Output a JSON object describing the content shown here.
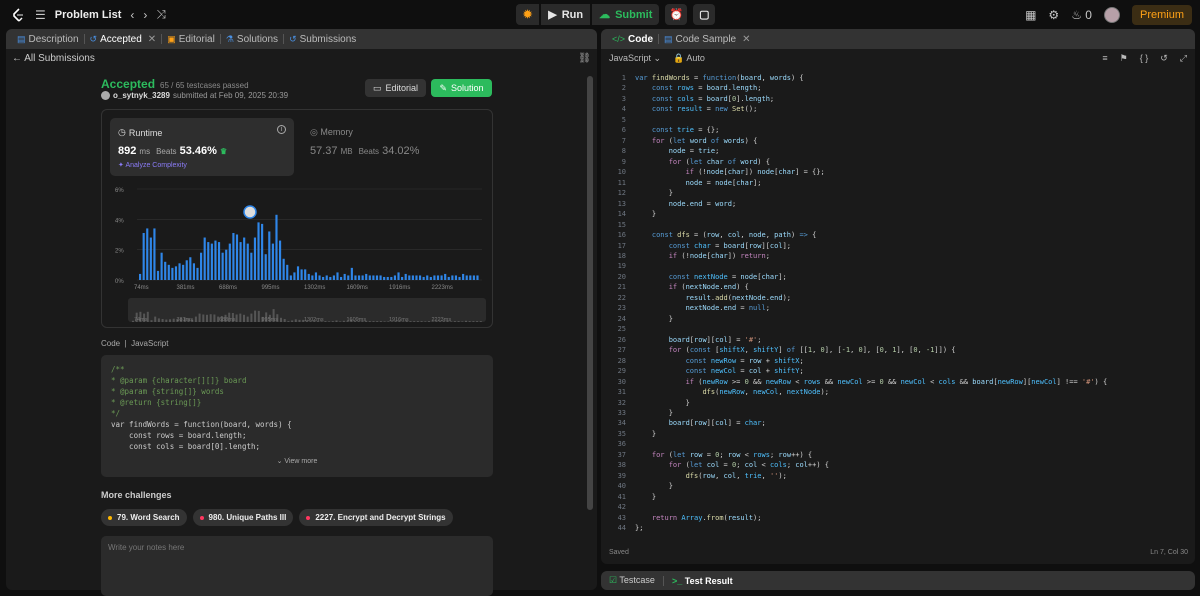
{
  "topbar": {
    "problem_list": "Problem List",
    "run": "Run",
    "submit": "Submit",
    "streak": "0",
    "premium": "Premium"
  },
  "left_tabs": [
    "Description",
    "Accepted",
    "Editorial",
    "Solutions",
    "Submissions"
  ],
  "all_submissions": "All Submissions",
  "result": {
    "status": "Accepted",
    "testcases": "65 / 65 testcases passed",
    "user": "o_sytnyk_3289",
    "submitted": "submitted at Feb 09, 2025 20:39",
    "editorial_btn": "Editorial",
    "solution_btn": "Solution"
  },
  "runtime": {
    "title": "Runtime",
    "value": "892",
    "unit": "ms",
    "beats_label": "Beats",
    "beats": "53.46%",
    "analyze": "Analyze Complexity"
  },
  "memory": {
    "title": "Memory",
    "value": "57.37",
    "unit": "MB",
    "beats_label": "Beats",
    "beats": "34.02%"
  },
  "chart_data": {
    "type": "bar",
    "y_ticks": [
      "6%",
      "4%",
      "2%",
      "0%"
    ],
    "x_ticks": [
      "74ms",
      "381ms",
      "688ms",
      "995ms",
      "1302ms",
      "1609ms",
      "1916ms",
      "2223ms"
    ],
    "ylim": [
      0,
      6
    ],
    "values": [
      0.4,
      3.1,
      3.4,
      2.8,
      3.4,
      0.6,
      1.8,
      1.2,
      1.0,
      0.8,
      0.9,
      1.1,
      1.0,
      1.3,
      1.5,
      1.1,
      0.8,
      1.8,
      2.8,
      2.5,
      2.4,
      2.6,
      2.5,
      1.8,
      2.0,
      2.4,
      3.1,
      3.0,
      2.5,
      2.8,
      2.4,
      1.8,
      2.8,
      3.8,
      3.7,
      1.7,
      3.2,
      2.4,
      4.3,
      2.6,
      1.4,
      1.0,
      0.3,
      0.5,
      0.9,
      0.7,
      0.7,
      0.4,
      0.3,
      0.5,
      0.3,
      0.2,
      0.3,
      0.2,
      0.3,
      0.5,
      0.2,
      0.4,
      0.3,
      0.8,
      0.3,
      0.3,
      0.3,
      0.4,
      0.3,
      0.3,
      0.3,
      0.3,
      0.2,
      0.2,
      0.2,
      0.3,
      0.5,
      0.2,
      0.4,
      0.3,
      0.3,
      0.3,
      0.3,
      0.2,
      0.3,
      0.2,
      0.3,
      0.3,
      0.3,
      0.4,
      0.2,
      0.3,
      0.3,
      0.2,
      0.4,
      0.3,
      0.3,
      0.3,
      0.3
    ]
  },
  "code_label": "Code",
  "code_lang": "JavaScript",
  "code_preview": [
    "/**",
    " * @param {character[][]} board",
    " * @param {string[]} words",
    " * @return {string[]}",
    " */",
    "var findWords = function(board, words) {",
    "    const rows = board.length;",
    "    const cols = board[0].length;"
  ],
  "view_more": "View more",
  "more_challenges": "More challenges",
  "challenges": [
    {
      "label": "79. Word Search",
      "color": "#ffb800"
    },
    {
      "label": "980. Unique Paths III",
      "color": "#ff375f"
    },
    {
      "label": "2227. Encrypt and Decrypt Strings",
      "color": "#ff375f"
    }
  ],
  "notes_placeholder": "Write your notes here",
  "right_tabs": [
    "Code",
    "Code Sample"
  ],
  "editor": {
    "language": "JavaScript",
    "auto": "Auto",
    "saved": "Saved",
    "cursor": "Ln 7, Col 30"
  },
  "bottom_tabs": [
    "Testcase",
    "Test Result"
  ]
}
